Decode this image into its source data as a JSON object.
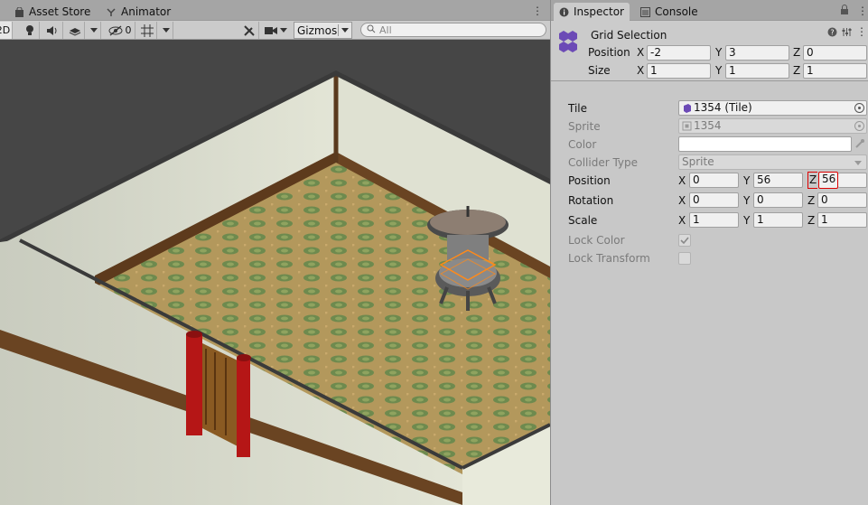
{
  "scene": {
    "tabs": [
      {
        "label": "Asset Store",
        "icon": "shopping-bag-icon"
      },
      {
        "label": "Animator",
        "icon": "animator-icon"
      }
    ],
    "toolbar": {
      "mode_label": "2D",
      "hidden_count": "0",
      "gizmos_label": "Gizmos",
      "search_placeholder": "All"
    }
  },
  "inspector": {
    "tabs": [
      {
        "label": "Inspector",
        "icon": "info-icon"
      },
      {
        "label": "Console",
        "icon": "console-icon"
      }
    ],
    "header": {
      "title": "Grid Selection",
      "position_label": "Position",
      "size_label": "Size",
      "position": {
        "x": "-2",
        "y": "3",
        "z": "0"
      },
      "size": {
        "x": "1",
        "y": "1",
        "z": "1"
      }
    },
    "axes": {
      "x": "X",
      "y": "Y",
      "z": "Z"
    },
    "properties": {
      "tile_label": "Tile",
      "tile_value": "1354 (Tile)",
      "sprite_label": "Sprite",
      "sprite_value": "1354",
      "color_label": "Color",
      "color_value": "#ffffff",
      "collider_label": "Collider Type",
      "collider_value": "Sprite",
      "position_label": "Position",
      "position": {
        "x": "0",
        "y": "56",
        "z": "56"
      },
      "rotation_label": "Rotation",
      "rotation": {
        "x": "0",
        "y": "0",
        "z": "0"
      },
      "scale_label": "Scale",
      "scale": {
        "x": "1",
        "y": "1",
        "z": "1"
      },
      "lock_color_label": "Lock Color",
      "lock_color_checked": true,
      "lock_transform_label": "Lock Transform",
      "lock_transform_checked": false
    }
  },
  "colors": {
    "accent_purple": "#6c4ab6",
    "highlight_red": "#dd0000",
    "panel_bg": "#c8c8c8",
    "tab_bg": "#a5a5a5"
  }
}
